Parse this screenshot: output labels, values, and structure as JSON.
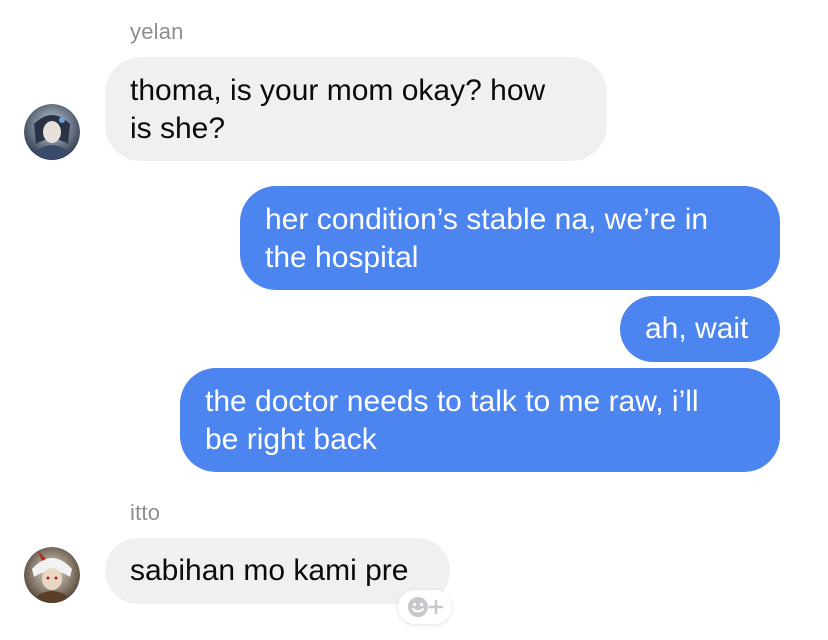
{
  "messages": [
    {
      "sender": "yelan",
      "direction": "incoming",
      "lines": [
        "thoma, is your mom okay? how",
        "is she?"
      ]
    },
    {
      "direction": "outgoing",
      "lines": [
        "her condition’s stable na, we’re in",
        "the hospital"
      ]
    },
    {
      "direction": "outgoing",
      "lines": [
        "ah, wait"
      ]
    },
    {
      "direction": "outgoing",
      "lines": [
        "the doctor needs to talk to me raw, i’ll",
        "be right back"
      ]
    },
    {
      "sender": "itto",
      "direction": "incoming",
      "lines": [
        "sabihan mo kami pre"
      ]
    }
  ],
  "icons": {
    "avatar_yelan": "avatar-yelan",
    "avatar_itto": "avatar-itto",
    "reaction": "add-reaction-icon"
  },
  "colors": {
    "incoming_bubble": "#f0f0f2",
    "outgoing_bubble": "#4c84f0",
    "sender_name": "#8e8e93"
  }
}
